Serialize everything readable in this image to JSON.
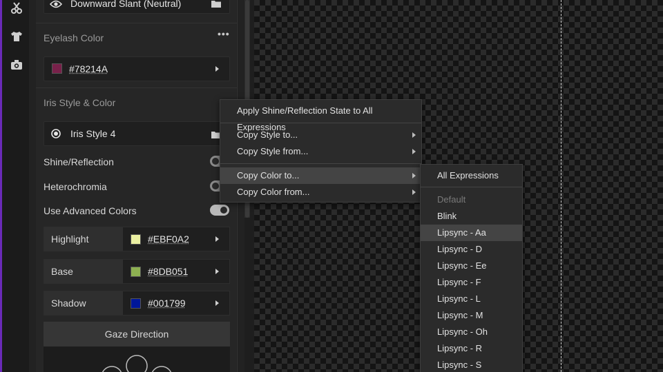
{
  "rail": {
    "icons": [
      "scissors-icon",
      "shirt-icon",
      "camera-icon"
    ]
  },
  "panel": {
    "mouth_shape": {
      "value": "Downward Slant (Neutral)"
    },
    "eyelash": {
      "title": "Eyelash Color",
      "more": "•••",
      "hex": "#78214A",
      "color": "#78214A"
    },
    "iris": {
      "title": "Iris Style & Color",
      "style_value": "Iris Style 4",
      "toggles": [
        {
          "label": "Shine/Reflection"
        },
        {
          "label": "Heterochromia"
        },
        {
          "label": "Use Advanced Colors"
        }
      ],
      "colors": [
        {
          "name": "Highlight",
          "hex": "#EBF0A2",
          "color": "#EBF0A2"
        },
        {
          "name": "Base",
          "hex": "#8DB051",
          "color": "#8DB051"
        },
        {
          "name": "Shadow",
          "hex": "#001799",
          "color": "#001799"
        }
      ]
    },
    "gaze": {
      "title": "Gaze Direction"
    }
  },
  "context_menu": {
    "items": [
      {
        "label": "Apply Shine/Reflection State to All Expressions"
      },
      {
        "label": "Copy Style to..."
      },
      {
        "label": "Copy Style from..."
      },
      {
        "label": "Copy Color to..."
      },
      {
        "label": "Copy Color from..."
      }
    ]
  },
  "submenu": {
    "all_label": "All Expressions",
    "items": [
      {
        "label": "Default",
        "disabled": true
      },
      {
        "label": "Blink"
      },
      {
        "label": "Lipsync - Aa"
      },
      {
        "label": "Lipsync - D"
      },
      {
        "label": "Lipsync - Ee"
      },
      {
        "label": "Lipsync - F"
      },
      {
        "label": "Lipsync - L"
      },
      {
        "label": "Lipsync - M"
      },
      {
        "label": "Lipsync - Oh"
      },
      {
        "label": "Lipsync - R"
      },
      {
        "label": "Lipsync - S"
      }
    ]
  }
}
